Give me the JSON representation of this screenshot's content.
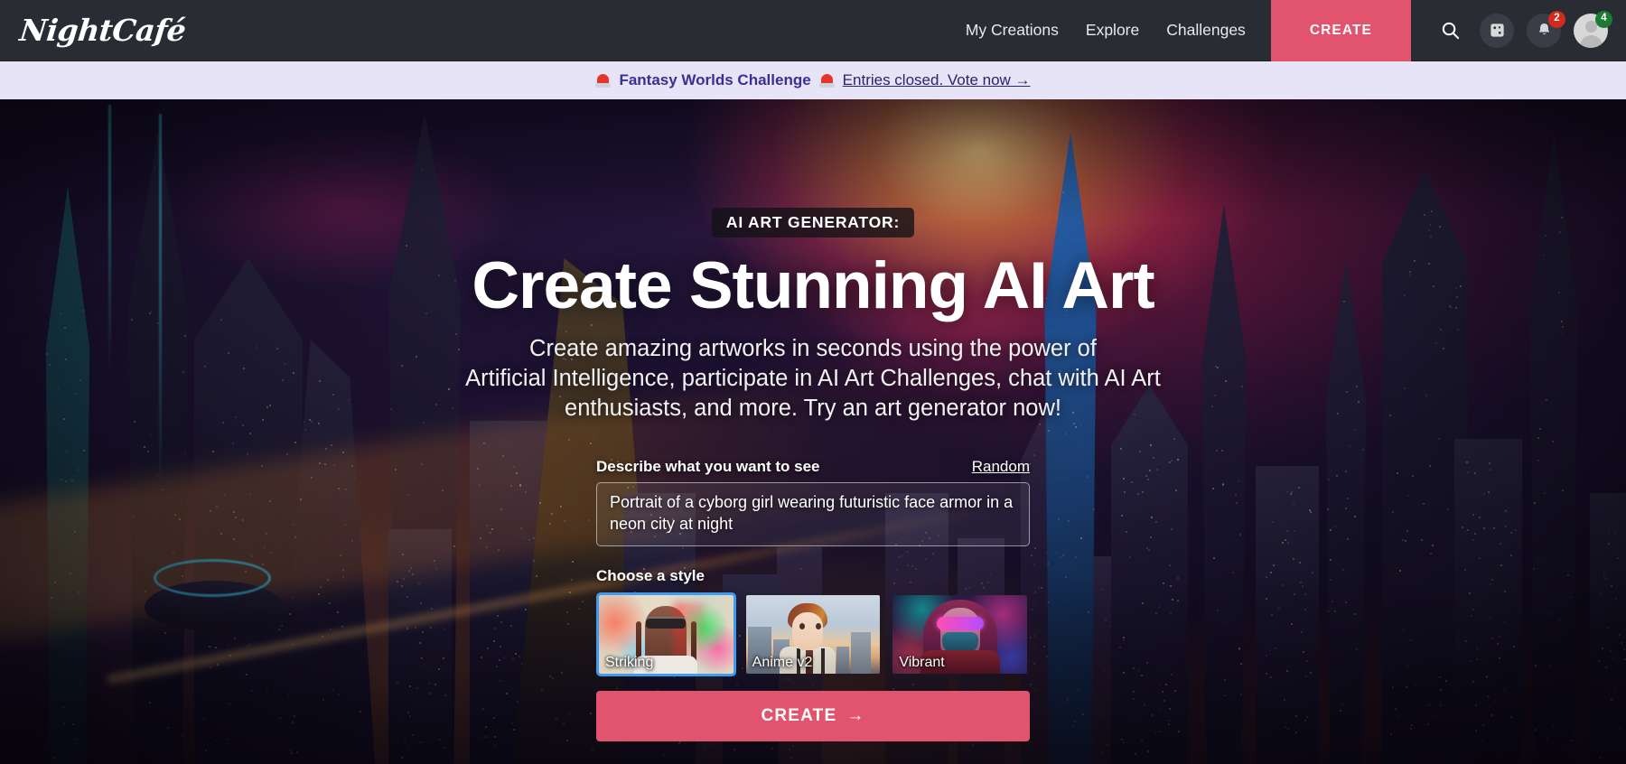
{
  "header": {
    "logo_text": "NightCafé",
    "nav": [
      {
        "label": "My Creations"
      },
      {
        "label": "Explore"
      },
      {
        "label": "Challenges"
      }
    ],
    "create_label": "CREATE",
    "icons": {
      "search": "search-icon",
      "dice": "dice-icon",
      "bell": "bell-icon",
      "avatar": "avatar-icon"
    },
    "notification_count": "2",
    "credit_count": "4"
  },
  "banner": {
    "icon_left": "siren-icon",
    "title": "Fantasy Worlds Challenge",
    "icon_right": "siren-icon",
    "link_text": "Entries closed. Vote now →"
  },
  "hero": {
    "eyebrow": "AI ART GENERATOR:",
    "title": "Create Stunning AI Art",
    "subtitle_line1": "Create amazing artworks in seconds using the power of",
    "subtitle_line2": "Artificial Intelligence, participate in AI Art Challenges, chat with AI Art",
    "subtitle_line3": "enthusiasts, and more. Try an art generator now!"
  },
  "form": {
    "prompt_label": "Describe what you want to see",
    "random_label": "Random",
    "prompt_value": "Portrait of a cyborg girl wearing futuristic face armor in a neon city at night",
    "prompt_placeholder": "Describe what you want to see",
    "style_label": "Choose a style",
    "styles": [
      {
        "name": "Striking",
        "selected": true
      },
      {
        "name": "Anime v2",
        "selected": false
      },
      {
        "name": "Vibrant",
        "selected": false
      }
    ],
    "create_label": "CREATE",
    "create_arrow": "→"
  },
  "colors": {
    "accent_pink": "#e2546e",
    "header_bg": "#292c33",
    "banner_bg": "#e7e4f8",
    "banner_text": "#3b2f8f",
    "selected_border": "#3d9bf0",
    "badge_red": "#d32a1e",
    "badge_green": "#1c7a32"
  }
}
